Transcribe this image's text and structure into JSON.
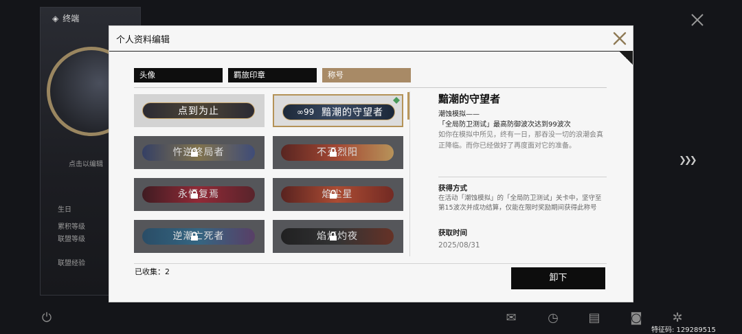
{
  "background": {
    "top_left_title": "终端",
    "left_texts": [
      "点击以编辑",
      "生日",
      "累积等级",
      "联盟等级",
      "联盟经验"
    ],
    "uid_text": "特征码: 129289515",
    "bottom_icons": [
      "power-icon",
      "mail-icon",
      "clock-icon",
      "notes-icon",
      "camera-icon",
      "settings-icon"
    ]
  },
  "modal": {
    "title": "个人资料编辑",
    "tabs": [
      {
        "label": "头像",
        "active": false
      },
      {
        "label": "羁旅印章",
        "active": false
      },
      {
        "label": "称号",
        "active": true
      }
    ],
    "titles_grid": [
      {
        "label": "点到为止",
        "state": "unlocked",
        "colors": [
          "#2b2a33",
          "#4d4536",
          "#2b2a33"
        ]
      },
      {
        "label": "黯潮的守望者",
        "state": "selected",
        "badge": "∞99",
        "colors": [
          "#1d2a3a",
          "#3a4a63",
          "#1b2738"
        ]
      },
      {
        "label": "忤逆终局者",
        "state": "locked",
        "colors": [
          "#2d3b68",
          "#8c7a4a",
          "#3a4a80"
        ]
      },
      {
        "label": "不灭烈阳",
        "state": "locked",
        "colors": [
          "#5a1a14",
          "#b8452a",
          "#d0a25a"
        ]
      },
      {
        "label": "永恒复焉",
        "state": "locked",
        "colors": [
          "#3a0d14",
          "#a11f2e",
          "#5a1820"
        ]
      },
      {
        "label": "焰尘星",
        "state": "locked",
        "colors": [
          "#5a1712",
          "#c24a2a",
          "#7a2016"
        ]
      },
      {
        "label": "逆潮亡死者",
        "state": "locked",
        "colors": [
          "#1f4b6a",
          "#2e6a8c",
          "#5a3a6a"
        ]
      },
      {
        "label": "焰灯灼夜",
        "state": "locked",
        "colors": [
          "#141414",
          "#2b2b2b",
          "#6a2a1a"
        ]
      }
    ],
    "detail": {
      "title": "黯潮的守望者",
      "subtitle": "潮蚀模拟——",
      "condition": "「全局防卫测试」最高防御波次达到99波次",
      "description": "如你在模拟中所见，终有一日，那吞没一切的浪潮会真正降临。而你已经做好了再度面对它的准备。",
      "method_label": "获得方式",
      "method_text": "在活动「潮蚀模拟」的「全局防卫测试」关卡中，坚守至第15波次并成功结算，仅能在限时奖励期间获得此称号",
      "time_label": "获取时间",
      "time_value": "2025/08/31"
    },
    "collected_text": "已收集：2",
    "unequip_label": "卸下"
  },
  "colors": {
    "accent": "#a88a66",
    "selected_border": "#b49257"
  }
}
